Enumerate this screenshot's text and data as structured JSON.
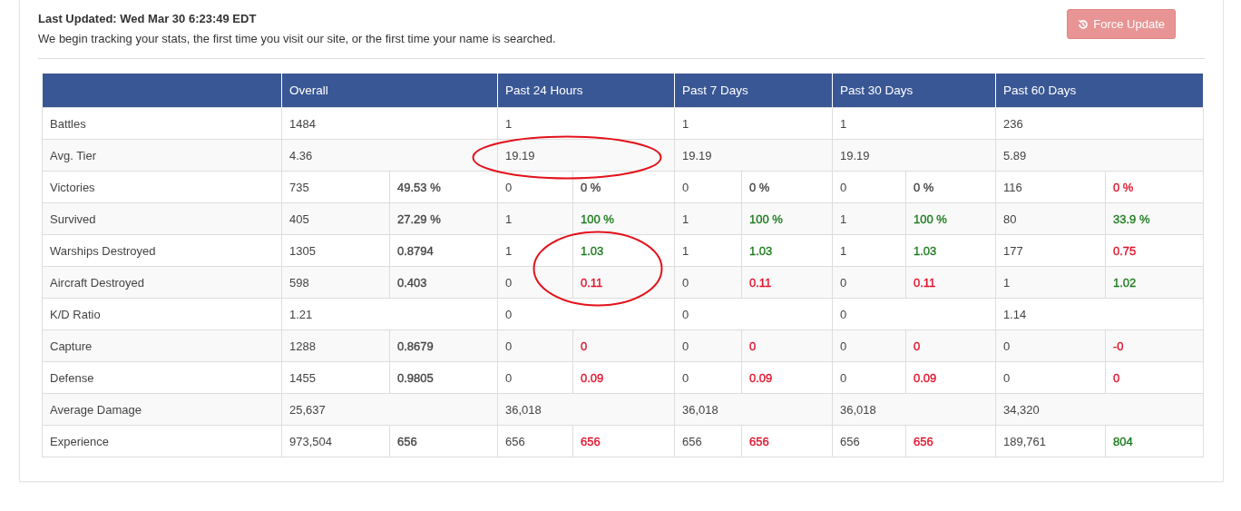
{
  "header": {
    "last_updated": "Last Updated: Wed Mar 30 6:23:49 EDT",
    "note": "We begin tracking your stats, the first time you visit our site, or the first time your name is searched.",
    "button": "Force Update"
  },
  "table": {
    "columns": [
      "Overall",
      "Past 24 Hours",
      "Past 7 Days",
      "Past 30 Days",
      "Past 60 Days"
    ],
    "rows": [
      {
        "label": "Battles",
        "cells": [
          {
            "value": "1484"
          },
          {
            "value": "1"
          },
          {
            "value": "1"
          },
          {
            "value": "1"
          },
          {
            "value": "236"
          }
        ]
      },
      {
        "label": "Avg. Tier",
        "cells": [
          {
            "value": "4.36"
          },
          {
            "value": "19.19",
            "circled": true
          },
          {
            "value": "19.19"
          },
          {
            "value": "19.19"
          },
          {
            "value": "5.89"
          }
        ]
      },
      {
        "label": "Victories",
        "cells": [
          {
            "value": "735",
            "ratio": "49.53 %",
            "color": "#444444"
          },
          {
            "value": "0",
            "ratio": "0 %",
            "color": "#444444"
          },
          {
            "value": "0",
            "ratio": "0 %",
            "color": "#444444"
          },
          {
            "value": "0",
            "ratio": "0 %",
            "color": "#444444"
          },
          {
            "value": "116",
            "ratio": "0 %",
            "color": "#e0102a"
          }
        ]
      },
      {
        "label": "Survived",
        "cells": [
          {
            "value": "405",
            "ratio": "27.29 %",
            "color": "#444444"
          },
          {
            "value": "1",
            "ratio": "100 %",
            "color": "#1c7a1c"
          },
          {
            "value": "1",
            "ratio": "100 %",
            "color": "#1c7a1c"
          },
          {
            "value": "1",
            "ratio": "100 %",
            "color": "#1c7a1c"
          },
          {
            "value": "80",
            "ratio": "33.9 %",
            "color": "#1c7a1c"
          }
        ]
      },
      {
        "label": "Warships Destroyed",
        "cells": [
          {
            "value": "1305",
            "ratio": "0.8794",
            "color": "#444444"
          },
          {
            "value": "1",
            "ratio": "1.03",
            "color": "#1c7a1c",
            "ratio_circled": true
          },
          {
            "value": "1",
            "ratio": "1.03",
            "color": "#1c7a1c"
          },
          {
            "value": "1",
            "ratio": "1.03",
            "color": "#1c7a1c"
          },
          {
            "value": "177",
            "ratio": "0.75",
            "color": "#e0102a"
          }
        ]
      },
      {
        "label": "Aircraft Destroyed",
        "cells": [
          {
            "value": "598",
            "ratio": "0.403",
            "color": "#444444"
          },
          {
            "value": "0",
            "ratio": "0.11",
            "color": "#e0102a",
            "ratio_circled": true
          },
          {
            "value": "0",
            "ratio": "0.11",
            "color": "#e0102a"
          },
          {
            "value": "0",
            "ratio": "0.11",
            "color": "#e0102a"
          },
          {
            "value": "1",
            "ratio": "1.02",
            "color": "#1c7a1c"
          }
        ]
      },
      {
        "label": "K/D Ratio",
        "cells": [
          {
            "value": "1.21"
          },
          {
            "value": "0"
          },
          {
            "value": "0"
          },
          {
            "value": "0"
          },
          {
            "value": "1.14"
          }
        ]
      },
      {
        "label": "Capture",
        "cells": [
          {
            "value": "1288",
            "ratio": "0.8679",
            "color": "#444444"
          },
          {
            "value": "0",
            "ratio": "0",
            "color": "#e0102a"
          },
          {
            "value": "0",
            "ratio": "0",
            "color": "#e0102a"
          },
          {
            "value": "0",
            "ratio": "0",
            "color": "#e0102a"
          },
          {
            "value": "0",
            "ratio": "-0",
            "color": "#e0102a"
          }
        ]
      },
      {
        "label": "Defense",
        "cells": [
          {
            "value": "1455",
            "ratio": "0.9805",
            "color": "#444444"
          },
          {
            "value": "0",
            "ratio": "0.09",
            "color": "#e0102a"
          },
          {
            "value": "0",
            "ratio": "0.09",
            "color": "#e0102a"
          },
          {
            "value": "0",
            "ratio": "0.09",
            "color": "#e0102a"
          },
          {
            "value": "0",
            "ratio": "0",
            "color": "#e0102a"
          }
        ]
      },
      {
        "label": "Average Damage",
        "cells": [
          {
            "value": "25,637"
          },
          {
            "value": "36,018"
          },
          {
            "value": "36,018"
          },
          {
            "value": "36,018"
          },
          {
            "value": "34,320"
          }
        ]
      },
      {
        "label": "Experience",
        "cells": [
          {
            "value": "973,504",
            "ratio": "656",
            "color": "#444444"
          },
          {
            "value": "656",
            "ratio": "656",
            "color": "#e0102a"
          },
          {
            "value": "656",
            "ratio": "656",
            "color": "#e0102a"
          },
          {
            "value": "656",
            "ratio": "656",
            "color": "#e0102a"
          },
          {
            "value": "189,761",
            "ratio": "804",
            "color": "#1c7a1c"
          }
        ]
      }
    ]
  }
}
